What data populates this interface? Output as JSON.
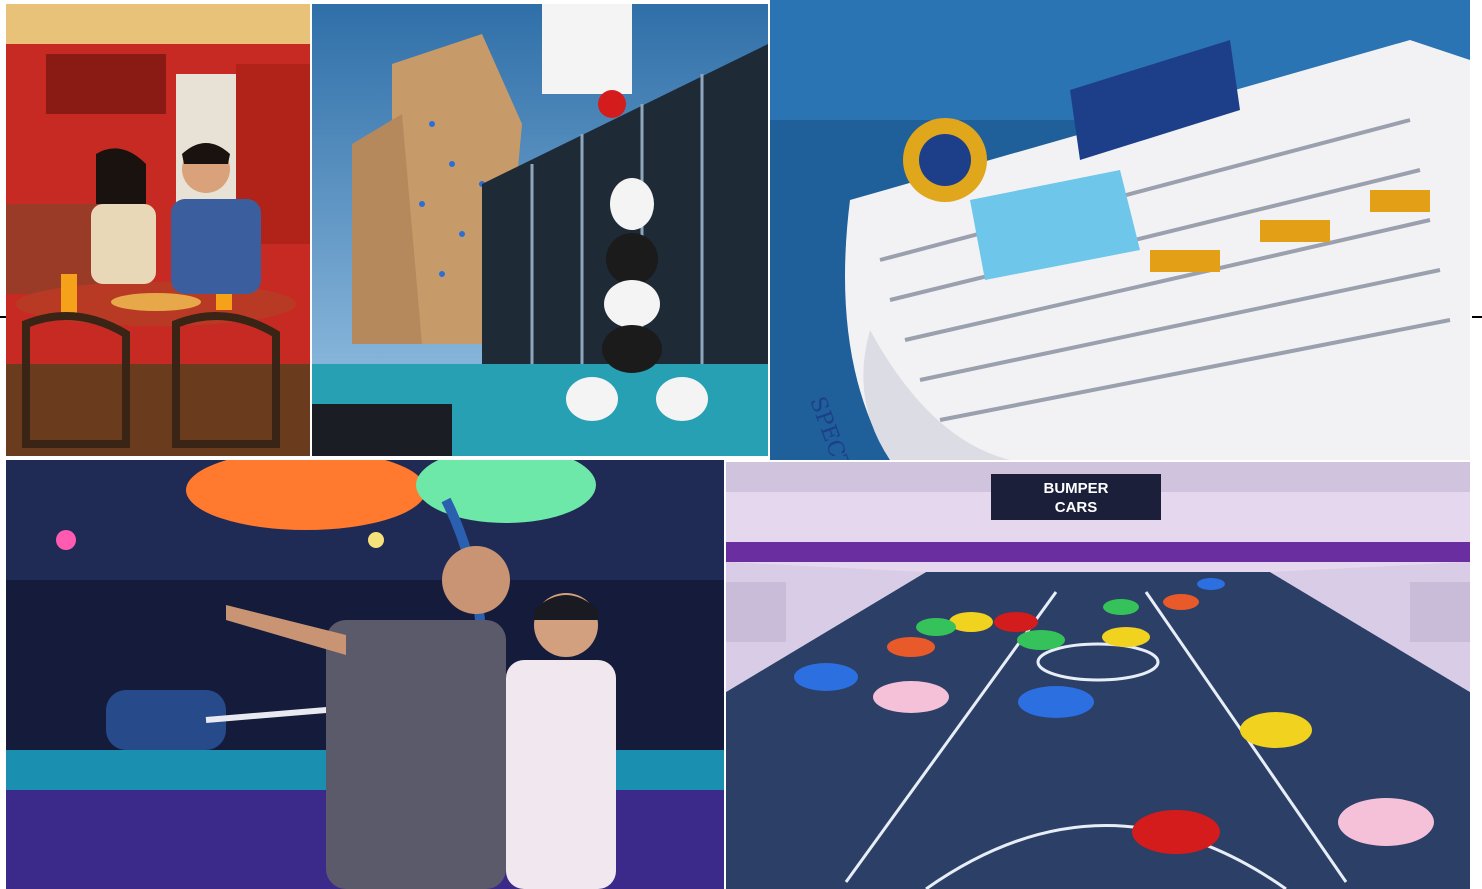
{
  "photos": {
    "pizza_restaurant": {
      "label": "pizza-restaurant-photo",
      "colors": {
        "wall": "#c62a22",
        "table": "#b93a24",
        "floor": "#6b3b1e",
        "chair": "#3a2416"
      }
    },
    "rock_wall_deck": {
      "label": "rock-climbing-wall-deck-photo",
      "colors": {
        "sky": "#3d7fb8",
        "wall": "#c79a6a",
        "glass": "#1e2a36",
        "floor": "#27a0b4"
      }
    },
    "ship_aerial": {
      "label": "cruise-ship-aerial-photo",
      "colors": {
        "sea": "#1f5f9a",
        "hull": "#f2f2f4",
        "accent": "#1d3f8a",
        "pool": "#6ec7ea"
      },
      "hull_lettering": "SPECTRUM"
    },
    "archery_deck": {
      "label": "indoor-archery-photo",
      "colors": {
        "ceiling": "#151b3a",
        "glow_orange": "#ff7a2e",
        "glow_green": "#6de8a8",
        "floor": "#3b2a8a"
      }
    },
    "bumper_cars": {
      "label": "bumper-cars-arena-photo",
      "colors": {
        "floor": "#2c3f66",
        "wall": "#e4d7ee",
        "rail": "#6b2ea0",
        "line": "#e8eef8"
      },
      "sign_text_line1": "BUMPER",
      "sign_text_line2": "CARS"
    }
  }
}
